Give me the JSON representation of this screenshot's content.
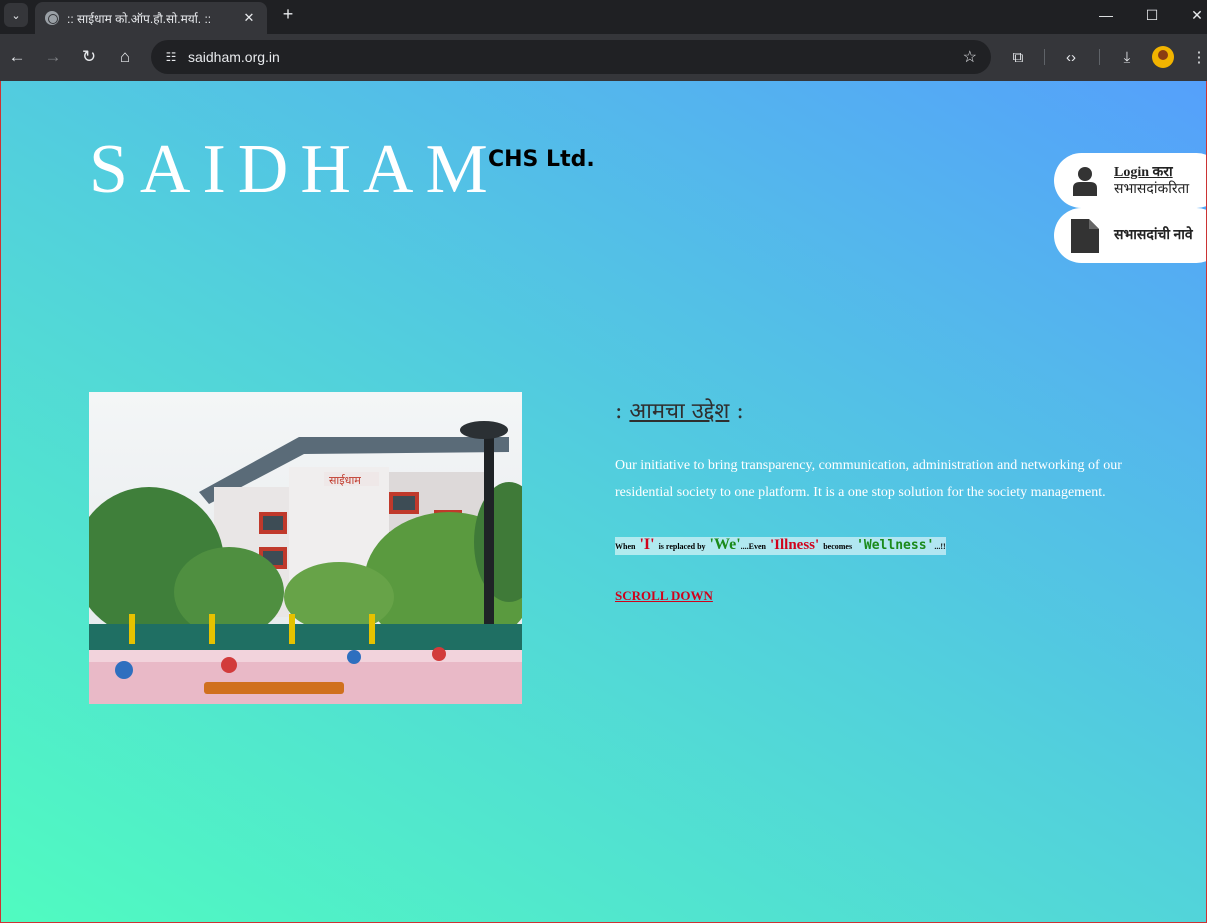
{
  "browser": {
    "tab_title": ":: साईधाम को.ऑप.हौ.सो.मर्या. ::",
    "url": "saidham.org.in"
  },
  "site": {
    "brand": "SAIDHAM",
    "brand_sub": "CHS Ltd."
  },
  "side_menu": {
    "login_link": "Login करा",
    "login_sub": "सभासदांकरिता",
    "members_label": "सभासदांची नावे"
  },
  "mission": {
    "title_prefix": ": ",
    "title": "आमचा उद्देश",
    "title_suffix": " :",
    "text": "Our initiative to bring transparency, communication, administration and networking of our residential society to one platform. It is a one stop solution for the society management.",
    "tagline": {
      "when": "When",
      "i": "'I'",
      "replaced": "is replaced by",
      "we": "'We'",
      "even": "....Even",
      "illness": "'Illness'",
      "becomes": "becomes",
      "wellness": "'Wellness'",
      "end": "...!!"
    },
    "scroll_down": "SCROLL DOWN"
  },
  "photo": {
    "sign_text": "साईधाम"
  }
}
